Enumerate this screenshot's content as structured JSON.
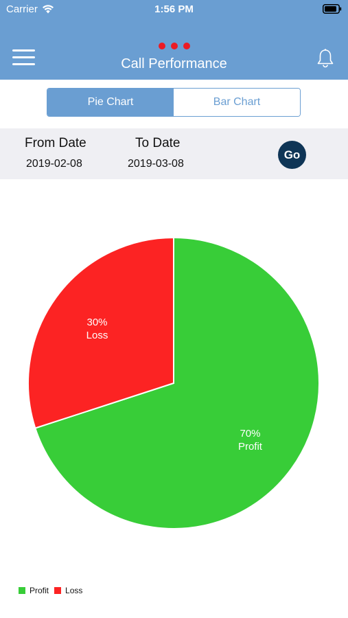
{
  "status_bar": {
    "carrier": "Carrier",
    "time": "1:56 PM"
  },
  "header": {
    "title": "Call Performance",
    "menu_icon": "hamburger-menu-icon",
    "notification_icon": "bell-icon"
  },
  "segmented_control": {
    "selected": "Pie Chart",
    "options": [
      "Pie Chart",
      "Bar Chart"
    ]
  },
  "date_filter": {
    "from_label": "From Date",
    "from_value": "2019-02-08",
    "to_label": "To Date",
    "to_value": "2019-03-08",
    "go_label": "Go"
  },
  "colors": {
    "header_background": "#6a9ed2",
    "accent": "#6a9ed2",
    "dots": "#ec1b24",
    "go_button": "#0f3556",
    "profit": "#38cd38",
    "loss": "#fc2323",
    "filter_bar": "#efeff3"
  },
  "chart_data": {
    "type": "pie",
    "slices": [
      {
        "name": "Profit",
        "value": 70,
        "percent_label": "70%",
        "color": "#38cd38"
      },
      {
        "name": "Loss",
        "value": 30,
        "percent_label": "30%",
        "color": "#fc2323"
      }
    ],
    "legend": [
      "Profit",
      "Loss"
    ],
    "legend_position": "bottom-left"
  }
}
